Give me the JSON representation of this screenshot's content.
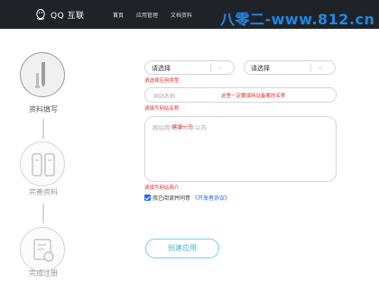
{
  "header": {
    "logo_text": "QQ 互联",
    "nav": [
      {
        "label": "首页"
      },
      {
        "label": "应用管理"
      },
      {
        "label": "文档资料"
      }
    ],
    "watermark": "八零二-www.812.cn"
  },
  "steps": [
    {
      "label": "资料填写",
      "active": true
    },
    {
      "label": "完善资料",
      "active": false
    },
    {
      "label": "完成注册",
      "active": false
    }
  ],
  "form": {
    "select_type": {
      "value": "请选择"
    },
    "select_subtype": {
      "value": "请选择"
    },
    "select_error": "请选择应用类型",
    "site_name": {
      "placeholder": "网站名称",
      "note": "这里一定要填网站备案的名称"
    },
    "site_name_error": "请填写网站名称",
    "site_intro": {
      "placeholder": "网站简介 200字以内",
      "note": "瞎填一下"
    },
    "site_intro_error": "请填写网站简介",
    "agree": {
      "text": "我已阅读并同意",
      "link": "《开发者协议》",
      "checked": true
    },
    "submit_label": "创建应用"
  },
  "colors": {
    "header_bg": "#1f2328",
    "error": "#e02d2d",
    "accent": "#1a73e8",
    "button_border": "#6fd0e6"
  },
  "icons": [
    "qq-penguin-icon",
    "pen-icon",
    "documents-icon",
    "certificate-icon",
    "chevron-down-icon",
    "checkbox-checked-icon"
  ]
}
